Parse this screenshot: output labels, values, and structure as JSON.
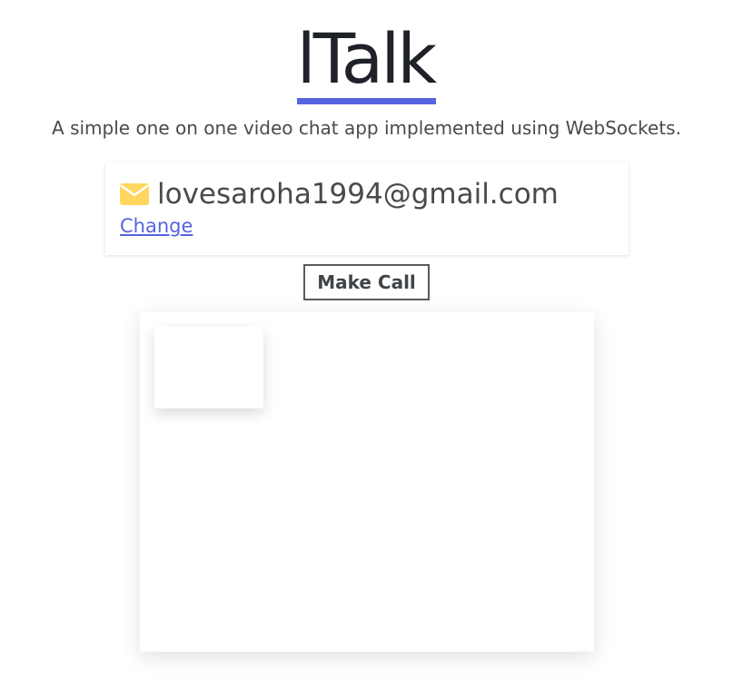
{
  "header": {
    "title": "lTalk",
    "subtitle": "A simple one on one video chat app implemented using WebSockets.",
    "accent_color": "#5664e0"
  },
  "user_card": {
    "icon": "mail-icon",
    "icon_color": "#ffd75e",
    "email": "lovesaroha1994@gmail.com",
    "change_label": "Change"
  },
  "actions": {
    "make_call_label": "Make Call"
  },
  "video": {
    "remote_video": "remote-video",
    "local_video": "local-video"
  }
}
